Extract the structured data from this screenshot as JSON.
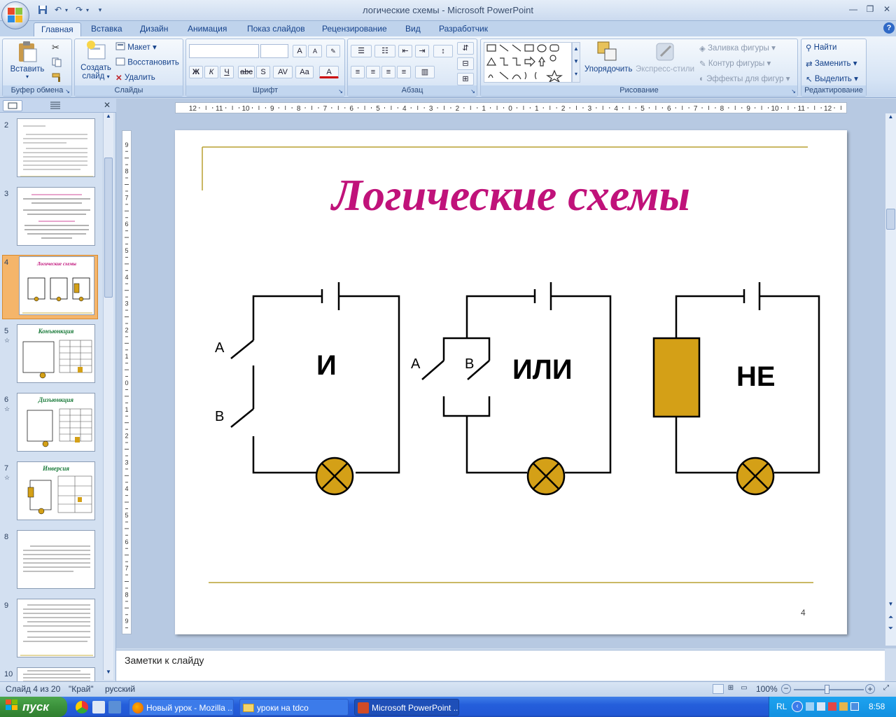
{
  "window": {
    "title": "логические схемы - Microsoft PowerPoint"
  },
  "ribbon_tabs": [
    "Главная",
    "Вставка",
    "Дизайн",
    "Анимация",
    "Показ слайдов",
    "Рецензирование",
    "Вид",
    "Разработчик"
  ],
  "ribbon": {
    "clipboard": {
      "paste": "Вставить",
      "label": "Буфер обмена"
    },
    "slides": {
      "new_slide_1": "Создать",
      "new_slide_2": "слайд",
      "layout": "Макет",
      "reset": "Восстановить",
      "delete": "Удалить",
      "label": "Слайды"
    },
    "font": {
      "label": "Шрифт",
      "bold": "Ж",
      "italic": "К",
      "underline": "Ч",
      "strike": "abc",
      "shadow": "S",
      "spacing": "AV",
      "case": "Aa",
      "color": "A",
      "grow": "A",
      "shrink": "A"
    },
    "paragraph": {
      "label": "Абзац"
    },
    "drawing": {
      "arrange": "Упорядочить",
      "quick_styles": "Экспресс-стили",
      "fill": "Заливка фигуры",
      "outline": "Контур фигуры",
      "effects": "Эффекты для фигур",
      "label": "Рисование"
    },
    "editing": {
      "find": "Найти",
      "replace": "Заменить",
      "select": "Выделить",
      "label": "Редактирование"
    }
  },
  "thumbnails": [
    {
      "num": "2",
      "star": "",
      "title": "",
      "lines": 9
    },
    {
      "num": "3",
      "star": "",
      "title": "",
      "lines": 10
    },
    {
      "num": "4",
      "star": "",
      "title": "Логические схемы",
      "lines": 0
    },
    {
      "num": "5",
      "star": "☆",
      "title": "Конъюнкция",
      "lines": 0
    },
    {
      "num": "6",
      "star": "☆",
      "title": "Дизъюнкция",
      "lines": 0
    },
    {
      "num": "7",
      "star": "☆",
      "title": "Инверсия",
      "lines": 0
    },
    {
      "num": "8",
      "star": "",
      "title": "",
      "lines": 8
    },
    {
      "num": "9",
      "star": "",
      "title": "",
      "lines": 9
    },
    {
      "num": "10",
      "star": "",
      "title": "",
      "lines": 4
    }
  ],
  "slide": {
    "title": "Логические схемы",
    "page_number": "4",
    "circuit_and": {
      "label": "И",
      "switch_a": "A",
      "switch_b": "B"
    },
    "circuit_or": {
      "label": "ИЛИ",
      "switch_a": "A",
      "switch_b": "B"
    },
    "circuit_not": {
      "label": "НЕ"
    },
    "colors": {
      "title": "#c0127a",
      "accent_line": "#b8a030",
      "component": "#d4a017",
      "wire": "#000000"
    }
  },
  "notes": {
    "placeholder": "Заметки к слайду"
  },
  "status": {
    "slide": "Слайд 4 из 20",
    "theme": "\"Край\"",
    "language": "русский",
    "zoom": "100%"
  },
  "taskbar": {
    "start": "пуск",
    "tasks": [
      "Новый урок - Mozilla ...",
      "уроки на tdco",
      "Microsoft PowerPoint ..."
    ],
    "lang": "RL",
    "clock": "8:58"
  }
}
